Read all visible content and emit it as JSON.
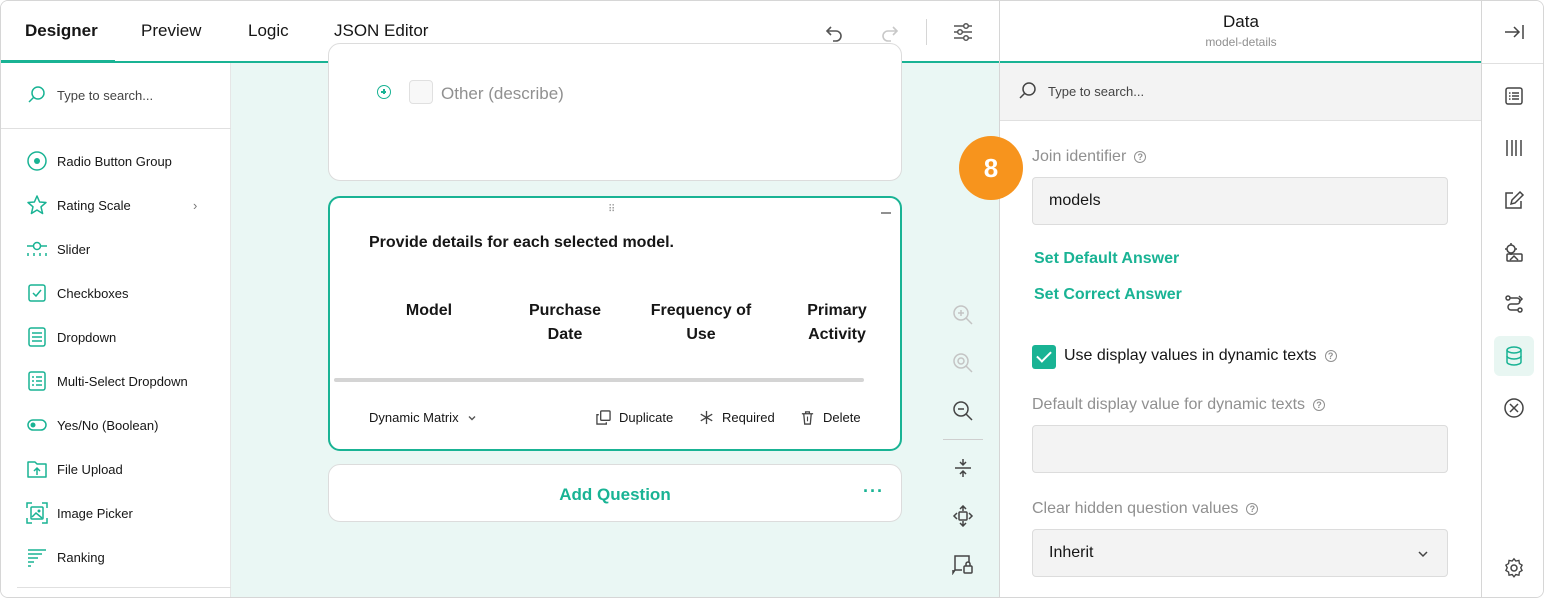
{
  "tabs": [
    {
      "label": "Designer",
      "active": true
    },
    {
      "label": "Preview",
      "active": false
    },
    {
      "label": "Logic",
      "active": false
    },
    {
      "label": "JSON Editor",
      "active": false
    }
  ],
  "toolbox": {
    "search_placeholder": "Type to search...",
    "items": [
      {
        "label": "Radio Button Group",
        "icon": "radio-icon"
      },
      {
        "label": "Rating Scale",
        "icon": "star-icon",
        "has_submenu": true
      },
      {
        "label": "Slider",
        "icon": "slider-icon"
      },
      {
        "label": "Checkboxes",
        "icon": "checkbox-icon"
      },
      {
        "label": "Dropdown",
        "icon": "dropdown-icon"
      },
      {
        "label": "Multi-Select Dropdown",
        "icon": "multi-dropdown-icon"
      },
      {
        "label": "Yes/No (Boolean)",
        "icon": "toggle-icon"
      },
      {
        "label": "File Upload",
        "icon": "file-upload-icon"
      },
      {
        "label": "Image Picker",
        "icon": "image-picker-icon"
      },
      {
        "label": "Ranking",
        "icon": "ranking-icon"
      }
    ]
  },
  "canvas": {
    "other_option": "Other (describe)",
    "question_title": "Provide details for each selected model.",
    "columns": [
      {
        "line1": "Model",
        "line2": ""
      },
      {
        "line1": "Purchase",
        "line2": "Date"
      },
      {
        "line1": "Frequency of",
        "line2": "Use"
      },
      {
        "line1": "Primary",
        "line2": "Activity"
      }
    ],
    "question_type": "Dynamic Matrix",
    "duplicate_label": "Duplicate",
    "required_label": "Required",
    "delete_label": "Delete",
    "add_question_label": "Add Question"
  },
  "properties": {
    "title": "Data",
    "subtitle": "model-details",
    "search_placeholder": "Type to search...",
    "step_badge": "8",
    "join_identifier_label": "Join identifier",
    "join_identifier_value": "models",
    "set_default_answer": "Set Default Answer",
    "set_correct_answer": "Set Correct Answer",
    "use_display_values_label": "Use display values in dynamic texts",
    "use_display_values_checked": true,
    "default_display_label": "Default display value for dynamic texts",
    "default_display_value": "",
    "clear_hidden_label": "Clear hidden question values",
    "clear_hidden_value": "Inherit"
  },
  "colors": {
    "accent": "#19b394",
    "badge": "#f7941d",
    "canvas_bg": "#eaf7f4"
  }
}
